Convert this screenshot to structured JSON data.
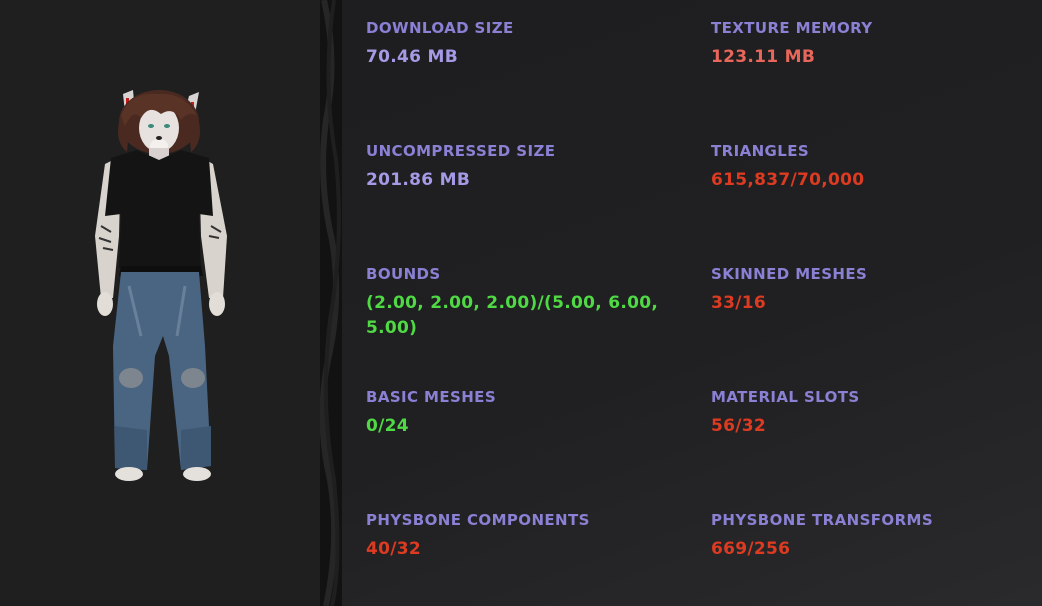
{
  "colors": {
    "label": "#8a80d4",
    "value_neutral": "#a59ae6",
    "value_warning": "#e8665a",
    "value_bad": "#dd3b21",
    "value_good": "#4fd944"
  },
  "avatar": {
    "icon": "avatar-preview-icon"
  },
  "stats": [
    {
      "key": "download_size",
      "label": "DOWNLOAD SIZE",
      "value": "70.46 MB",
      "status": "neutral"
    },
    {
      "key": "texture_memory",
      "label": "TEXTURE MEMORY",
      "value": "123.11 MB",
      "status": "warning"
    },
    {
      "key": "uncompressed_size",
      "label": "UNCOMPRESSED SIZE",
      "value": "201.86 MB",
      "status": "neutral"
    },
    {
      "key": "triangles",
      "label": "TRIANGLES",
      "value": "615,837/70,000",
      "status": "bad"
    },
    {
      "key": "bounds",
      "label": "BOUNDS",
      "value": "(2.00, 2.00, 2.00)/(5.00, 6.00, 5.00)",
      "status": "good"
    },
    {
      "key": "skinned_meshes",
      "label": "SKINNED MESHES",
      "value": "33/16",
      "status": "bad"
    },
    {
      "key": "basic_meshes",
      "label": "BASIC MESHES",
      "value": "0/24",
      "status": "good"
    },
    {
      "key": "material_slots",
      "label": "MATERIAL SLOTS",
      "value": "56/32",
      "status": "bad"
    },
    {
      "key": "physbone_components",
      "label": "PHYSBONE COMPONENTS",
      "value": "40/32",
      "status": "bad"
    },
    {
      "key": "physbone_transforms",
      "label": "PHYSBONE TRANSFORMS",
      "value": "669/256",
      "status": "bad"
    }
  ]
}
